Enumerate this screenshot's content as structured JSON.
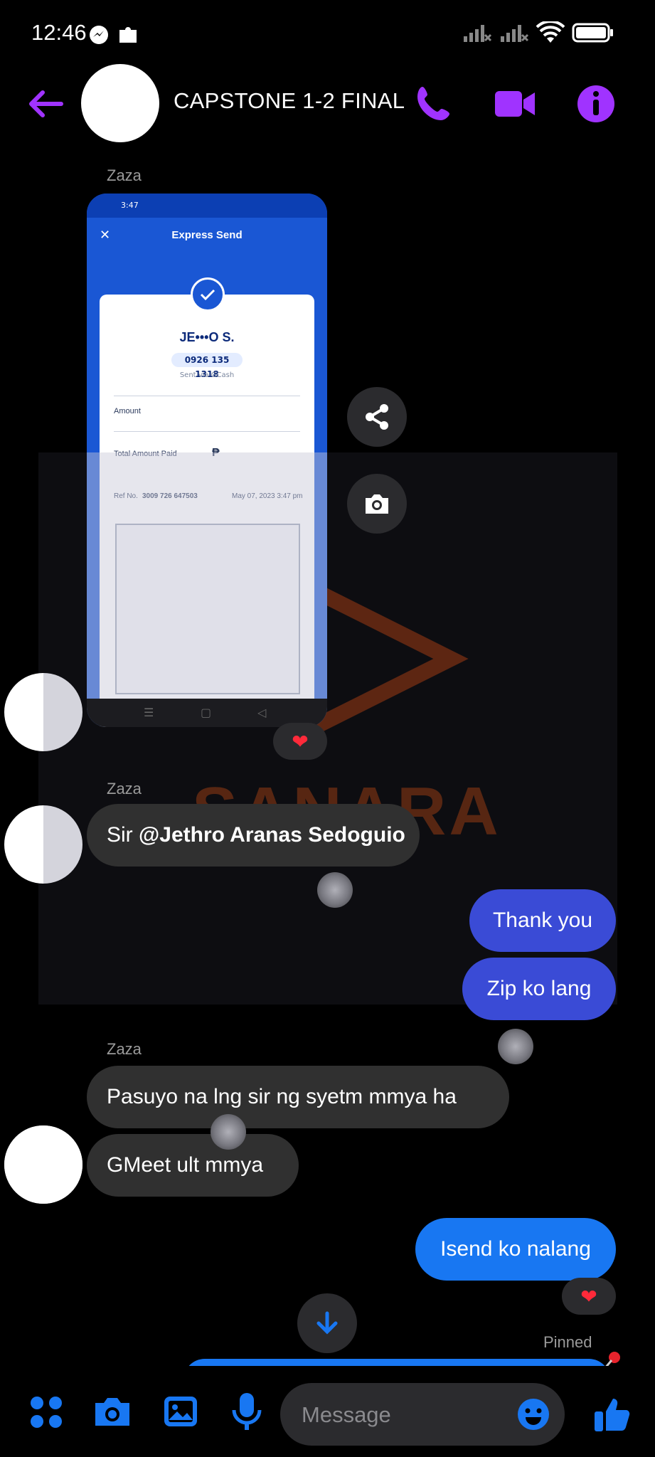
{
  "status_bar": {
    "time": "12:46"
  },
  "header": {
    "title": "CAPSTONE 1-2 FINAL"
  },
  "receipt": {
    "time": "3:47",
    "title": "Express Send",
    "recipient": "JE•••O S.",
    "phone": "0926 135 1318",
    "sent_via": "Sent via GCash",
    "amount_label": "Amount",
    "total_label": "Total Amount Paid",
    "currency": "₱",
    "ref_label": "Ref No.",
    "ref_no": "3009 726 647503",
    "date": "May 07, 2023 3:47 pm"
  },
  "messages": {
    "sender_1": "Zaza",
    "sender_2": "Zaza",
    "sender_3": "Zaza",
    "mention_prefix": "Sir ",
    "mention_name": "@Jethro Aranas Sedoguio",
    "out_1": "Thank you",
    "out_2": "Zip ko lang",
    "in_1": "Pasuyo na lng sir ng syetm mmya ha",
    "in_2": "GMeet ult  mmya",
    "out_3": "Isend ko nalang",
    "pinned": "Pinned"
  },
  "reaction": "❤",
  "watermark": "SANARA",
  "composer": {
    "placeholder": "Message"
  },
  "colors": {
    "accent": "#a033ff",
    "messenger_blue": "#1877f2",
    "bubble_out": "#3a4bd6",
    "bubble_in": "#303030"
  }
}
